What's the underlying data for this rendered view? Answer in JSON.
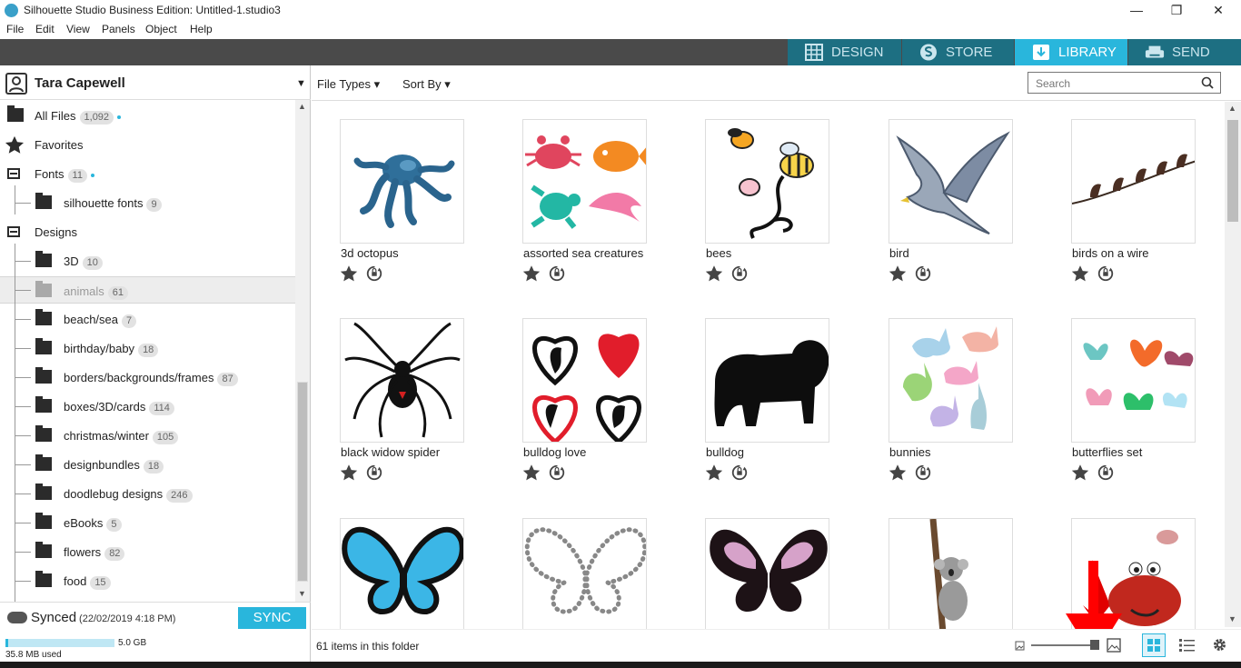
{
  "window": {
    "title": "Silhouette Studio Business Edition: Untitled-1.studio3"
  },
  "menu": [
    "File",
    "Edit",
    "View",
    "Panels",
    "Object",
    "Help"
  ],
  "tabs": [
    {
      "label": "DESIGN",
      "icon": "grid-icon",
      "active": false
    },
    {
      "label": "STORE",
      "icon": "store-icon",
      "active": false
    },
    {
      "label": "LIBRARY",
      "icon": "library-download-icon",
      "active": true
    },
    {
      "label": "SEND",
      "icon": "printer-icon",
      "active": false
    }
  ],
  "sidebar": {
    "user": "Tara Capewell",
    "tree": [
      {
        "label": "All Files",
        "count": "1,092",
        "kind": "folder",
        "level": 0,
        "dot": true
      },
      {
        "label": "Favorites",
        "count": "",
        "kind": "star",
        "level": 0
      },
      {
        "label": "Fonts",
        "count": "11",
        "kind": "minus",
        "level": 0,
        "dot": true
      },
      {
        "label": "silhouette fonts",
        "count": "9",
        "kind": "folder",
        "level": 1
      },
      {
        "label": "Designs",
        "count": "",
        "kind": "minus",
        "level": 0
      },
      {
        "label": "3D",
        "count": "10",
        "kind": "folder",
        "level": 1
      },
      {
        "label": "animals",
        "count": "61",
        "kind": "folder",
        "level": 1,
        "selected": true
      },
      {
        "label": "beach/sea",
        "count": "7",
        "kind": "folder",
        "level": 1
      },
      {
        "label": "birthday/baby",
        "count": "18",
        "kind": "folder",
        "level": 1
      },
      {
        "label": "borders/backgrounds/frames",
        "count": "87",
        "kind": "folder",
        "level": 1
      },
      {
        "label": "boxes/3D/cards",
        "count": "114",
        "kind": "folder",
        "level": 1
      },
      {
        "label": "christmas/winter",
        "count": "105",
        "kind": "folder",
        "level": 1
      },
      {
        "label": "designbundles",
        "count": "18",
        "kind": "folder",
        "level": 1
      },
      {
        "label": "doodlebug designs",
        "count": "246",
        "kind": "folder",
        "level": 1
      },
      {
        "label": "eBooks",
        "count": "5",
        "kind": "folder",
        "level": 1
      },
      {
        "label": "flowers",
        "count": "82",
        "kind": "folder",
        "level": 1
      },
      {
        "label": "food",
        "count": "15",
        "kind": "folder",
        "level": 1
      }
    ],
    "sync": {
      "status": "Synced",
      "timestamp": "(22/02/2019 4:18 PM)",
      "button": "SYNC",
      "quota_max": "5.0 GB",
      "used": "35.8 MB used",
      "used_fraction": 0.007
    }
  },
  "toolbar": {
    "file_types": "File Types",
    "sort_by": "Sort By",
    "search_placeholder": "Search"
  },
  "items": [
    {
      "title": "3d octopus",
      "art": "octopus"
    },
    {
      "title": "assorted sea creatures",
      "art": "sea"
    },
    {
      "title": "bees",
      "art": "bees"
    },
    {
      "title": "bird",
      "art": "bird"
    },
    {
      "title": "birds on a wire",
      "art": "wire"
    },
    {
      "title": "black widow spider",
      "art": "spider"
    },
    {
      "title": "bulldog love",
      "art": "hearts"
    },
    {
      "title": "bulldog",
      "art": "bulldog"
    },
    {
      "title": "bunnies",
      "art": "bunnies"
    },
    {
      "title": "butterflies set",
      "art": "butterflies"
    },
    {
      "title": "",
      "art": "bluebutterfly"
    },
    {
      "title": "",
      "art": "dotbutterfly"
    },
    {
      "title": "",
      "art": "pinkbutterfly"
    },
    {
      "title": "",
      "art": "koala"
    },
    {
      "title": "",
      "art": "crab"
    }
  ],
  "status": {
    "count_text": "61 items in this folder"
  },
  "colors": {
    "accent": "#29b6dc",
    "tab_inactive": "#1d6f82",
    "topbar": "#4a4a4a"
  }
}
